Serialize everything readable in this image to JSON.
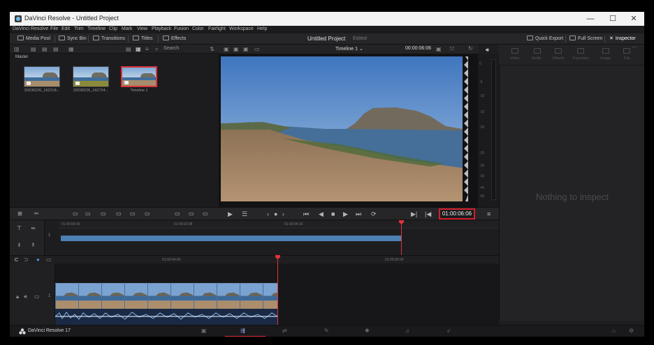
{
  "window": {
    "title": "DaVinci Resolve - Untitled Project",
    "controls": {
      "minimize": "—",
      "maximize": "☐",
      "close": "✕"
    }
  },
  "menu": [
    "DaVinci Resolve",
    "File",
    "Edit",
    "Trim",
    "Timeline",
    "Clip",
    "Mark",
    "View",
    "Playback",
    "Fusion",
    "Color",
    "Fairlight",
    "Workspace",
    "Help"
  ],
  "toolbar": {
    "media_pool": "Media Pool",
    "sync_bin": "Sync Bin",
    "transitions": "Transitions",
    "titles": "Titles",
    "effects": "Effects",
    "project_title": "Untitled Project",
    "edited": "Edited",
    "quick_export": "Quick Export",
    "full_screen": "Full Screen",
    "inspector": "Inspector"
  },
  "media_pool": {
    "search_label": "Search",
    "bin": "Master",
    "clips": [
      {
        "label": "20230226_162218...",
        "icon": "audio-video-icon"
      },
      {
        "label": "20230226_162724...",
        "icon": "video-icon"
      },
      {
        "label": "Timeline 1",
        "icon": "timeline-icon"
      }
    ]
  },
  "viewer": {
    "timeline_name": "Timeline 1",
    "duration": "00:00:06:06"
  },
  "meters": {
    "scale": [
      "0",
      "-5",
      "-10",
      "-15",
      "-20",
      "-25",
      "-30",
      "-35",
      "-40",
      "-50"
    ]
  },
  "inspector": {
    "tabs": [
      "Video",
      "Audio",
      "Effects",
      "Transition",
      "Image",
      "File"
    ],
    "empty_text": "Nothing to inspect"
  },
  "transport": {
    "timecode": "01:00:06:06"
  },
  "timeline": {
    "ruler_upper": [
      "01:00:00:00",
      "01:00:02:08",
      "01:00:04:16"
    ],
    "ruler_lower": [
      "01:00:04:00",
      "01:00:06:00"
    ]
  },
  "pagebar": {
    "brand": "DaVinci Resolve 17"
  }
}
